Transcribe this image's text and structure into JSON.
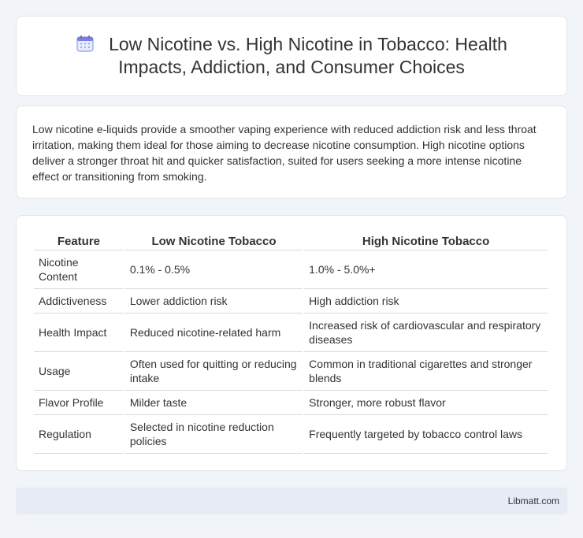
{
  "header": {
    "icon": "calendar-icon",
    "title": "Low Nicotine vs. High Nicotine in Tobacco: Health Impacts, Addiction, and Consumer Choices"
  },
  "summary": {
    "text": "Low nicotine e-liquids provide a smoother vaping experience with reduced addiction risk and less throat irritation, making them ideal for those aiming to decrease nicotine consumption. High nicotine options deliver a stronger throat hit and quicker satisfaction, suited for users seeking a more intense nicotine effect or transitioning from smoking."
  },
  "table": {
    "headers": [
      "Feature",
      "Low Nicotine Tobacco",
      "High Nicotine Tobacco"
    ],
    "rows": [
      [
        "Nicotine Content",
        "0.1% - 0.5%",
        "1.0% - 5.0%+"
      ],
      [
        "Addictiveness",
        "Lower addiction risk",
        "High addiction risk"
      ],
      [
        "Health Impact",
        "Reduced nicotine-related harm",
        "Increased risk of cardiovascular and respiratory diseases"
      ],
      [
        "Usage",
        "Often used for quitting or reducing intake",
        "Common in traditional cigarettes and stronger blends"
      ],
      [
        "Flavor Profile",
        "Milder taste",
        "Stronger, more robust flavor"
      ],
      [
        "Regulation",
        "Selected in nicotine reduction policies",
        "Frequently targeted by tobacco control laws"
      ]
    ]
  },
  "footer": {
    "brand": "Libmatt.com"
  },
  "colors": {
    "background": "#f1f4f9",
    "card": "#ffffff",
    "footer": "#e6ebf5",
    "icon_accent": "#7b8cf0"
  }
}
